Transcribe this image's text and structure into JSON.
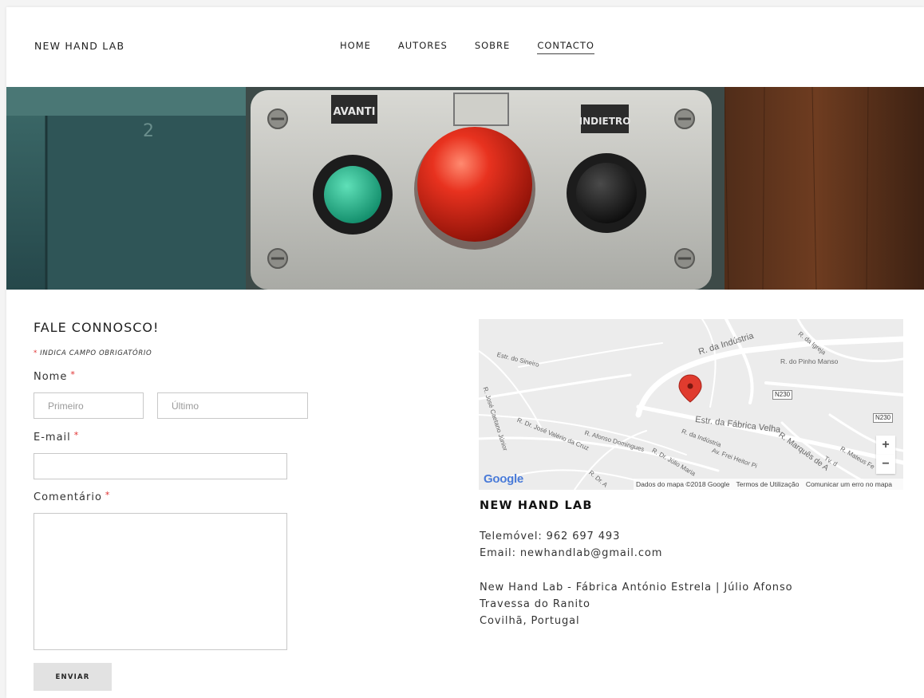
{
  "header": {
    "site_title": "NEW HAND LAB",
    "nav": [
      {
        "label": "HOME"
      },
      {
        "label": "AUTORES"
      },
      {
        "label": "SOBRE"
      },
      {
        "label": "CONTACTO",
        "active": true
      }
    ]
  },
  "hero": {
    "label_left": "AVANTI",
    "label_right": "INDIETRO",
    "panel_number": "2"
  },
  "form": {
    "title": "FALE CONNOSCO!",
    "required_note": "INDICA CAMPO OBRIGATÓRIO",
    "required_mark": "*",
    "name_label": "Nome",
    "first_placeholder": "Primeiro",
    "last_placeholder": "Último",
    "email_label": "E-mail",
    "comment_label": "Comentário",
    "submit_label": "ENVIAR"
  },
  "map": {
    "labels": {
      "industria": "R. da Indústria",
      "igreja": "R. da Igreja",
      "pinho_manso": "R. do Pinho Manso",
      "sineiro": "Estr. do Sineiro",
      "jose_caetano": "R. José Caetano Júnior",
      "jose_valerio": "R. Dr. José Valério da Cruz",
      "afonso_dom": "R. Afonso Domingues",
      "julio_maria": "R. Dr. Júlio Maria",
      "fabrica_velha": "Estr. da Fábrica Velha",
      "industria2": "R. da Indústria",
      "frei_heitor": "Av. Frei Heitor Pi",
      "marques": "R. Marquês de A",
      "mateus": "R. Mateus Fe",
      "tv": "Tv. d",
      "dr_a": "R. Dr. A"
    },
    "road_shield_1": "N230",
    "road_shield_2": "N230",
    "zoom_in": "+",
    "zoom_out": "−",
    "logo": "Google",
    "footer": {
      "data": "Dados do mapa ©2018 Google",
      "terms": "Termos de Utilização",
      "report": "Comunicar um erro no mapa"
    }
  },
  "contact": {
    "title": "NEW HAND LAB",
    "phone": "Telemóvel: 962 697 493",
    "email": "Email: newhandlab@gmail.com",
    "address_1": "New Hand Lab - Fábrica António Estrela | Júlio Afonso",
    "address_2": "Travessa do Ranito",
    "address_3": "Covilhã, Portugal"
  },
  "colors": {
    "accent_required": "#e03030",
    "map_pin": "#e03b2e",
    "button_bg": "#e2e2e2"
  }
}
